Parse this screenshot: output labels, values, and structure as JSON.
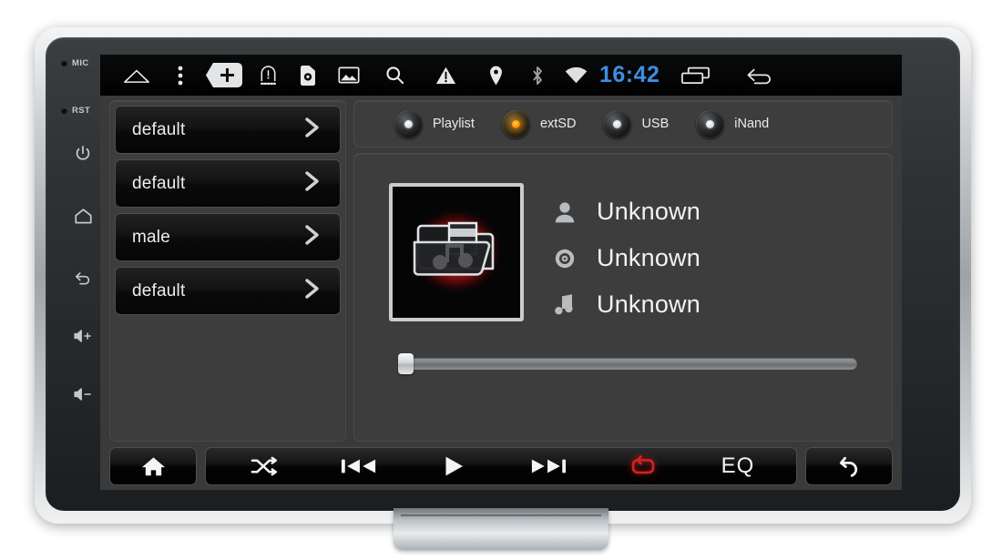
{
  "device": {
    "bezel_keys": [
      {
        "name": "mic-pinhole",
        "label": "MIC"
      },
      {
        "name": "reset-pinhole",
        "label": "RST"
      },
      {
        "name": "power-key",
        "label": ""
      },
      {
        "name": "home-key",
        "label": ""
      },
      {
        "name": "back-key",
        "label": ""
      },
      {
        "name": "volume-up-key",
        "label": ""
      },
      {
        "name": "volume-down-key",
        "label": ""
      }
    ]
  },
  "statusbar": {
    "clock": "16:42",
    "clock_color": "#3d8fe0",
    "icons": [
      "home-icon",
      "overflow-menu-icon",
      "add-tag-icon",
      "tire-pressure-warning-icon",
      "sim-settings-icon",
      "gallery-icon",
      "search-icon",
      "warning-icon",
      "location-pin-icon",
      "bluetooth-icon",
      "wifi-icon"
    ],
    "right_icons": [
      "recent-apps-icon",
      "back-icon"
    ]
  },
  "file_list": {
    "items": [
      {
        "label": "default"
      },
      {
        "label": "default"
      },
      {
        "label": "male"
      },
      {
        "label": "default"
      }
    ]
  },
  "sources": {
    "items": [
      {
        "label": "Playlist",
        "active": false
      },
      {
        "label": "extSD",
        "active": true
      },
      {
        "label": "USB",
        "active": false
      },
      {
        "label": "iNand",
        "active": false
      }
    ],
    "active_color": "#ff9500"
  },
  "now_playing": {
    "album_art": "music-folder-placeholder",
    "artist": "Unknown",
    "album": "Unknown",
    "title": "Unknown",
    "progress_percent": 0
  },
  "transport": {
    "home_label": "home-icon",
    "shuffle_label": "shuffle-icon",
    "previous_label": "previous-track-icon",
    "play_label": "play-icon",
    "next_label": "next-track-icon",
    "repeat_label": "repeat-icon",
    "repeat_active": true,
    "repeat_color": "#d61f1f",
    "eq_label": "EQ",
    "back_label": "back-icon"
  }
}
